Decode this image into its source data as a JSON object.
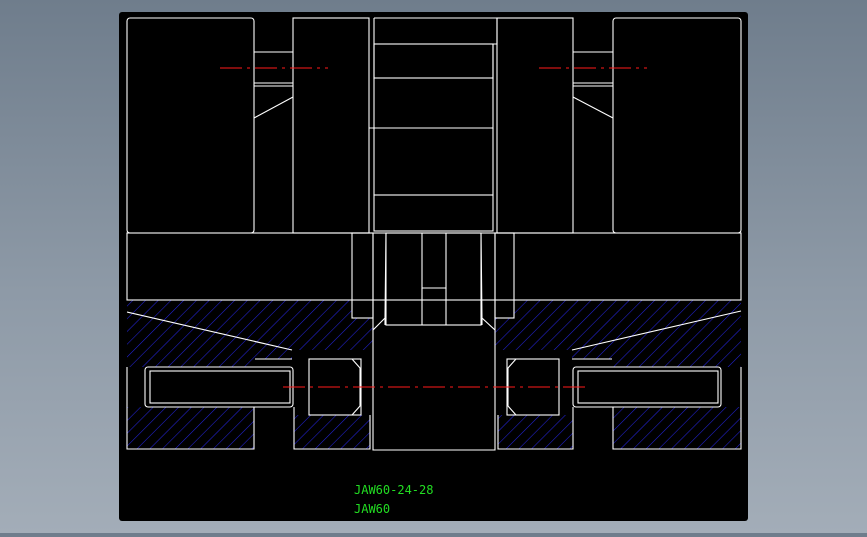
{
  "drawing": {
    "part_number": "JAW60-24-28",
    "model": "JAW60"
  },
  "colors": {
    "background": "#7f8c9a",
    "paper": "#000000",
    "outline": "#ffffff",
    "hatch": "#2323d8",
    "center_line": "#ff1a1a",
    "label_text": "#22dd22"
  }
}
